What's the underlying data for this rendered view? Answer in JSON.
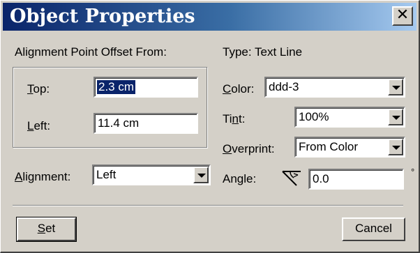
{
  "window": {
    "title": "Object Properties",
    "close_glyph": "✕"
  },
  "offset": {
    "heading": "Alignment Point Offset From:",
    "top": {
      "label_key": "T",
      "label_rest": "op:",
      "value": "2.3 cm"
    },
    "left": {
      "label_key": "L",
      "label_rest": "eft:",
      "value": "11.4 cm"
    }
  },
  "alignment": {
    "label_key": "A",
    "label_rest": "lignment:",
    "value": "Left"
  },
  "type_label": "Type: Text Line",
  "color": {
    "label_key": "C",
    "label_rest": "olor:",
    "value": "ddd-3"
  },
  "tint": {
    "label_pre": "Ti",
    "label_key": "n",
    "label_rest": "t:",
    "value": "100%"
  },
  "overprint": {
    "label_key": "O",
    "label_rest": "verprint:",
    "value": "From Color"
  },
  "angle": {
    "label_pre": "An",
    "label_key": "g",
    "label_rest": "le:",
    "value": "0.0",
    "unit": "°",
    "icon": "angle-icon"
  },
  "buttons": {
    "set_key": "S",
    "set_rest": "et",
    "cancel": "Cancel"
  }
}
